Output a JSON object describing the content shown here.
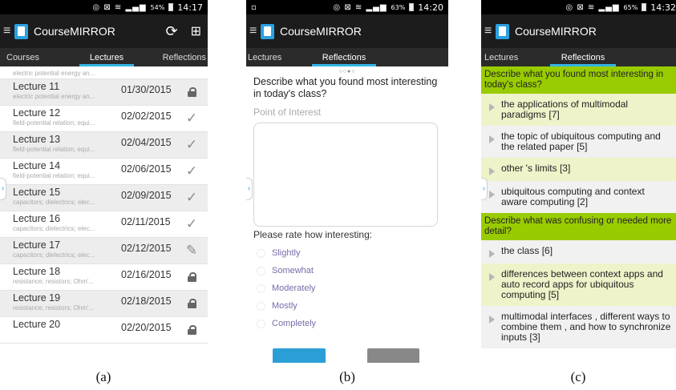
{
  "panel_a": {
    "time": "14:17",
    "battery": "54%",
    "app_title": "CourseMIRROR",
    "tabs": [
      "Courses",
      "Lectures",
      "Reflections"
    ],
    "partial_top_subtitle": "electric potential energy an...",
    "lectures": [
      {
        "name": "Lecture 11",
        "subtitle": "electric potential energy an...",
        "date": "01/30/2015",
        "status": "lock-icon"
      },
      {
        "name": "Lecture 12",
        "subtitle": "field-potential relation; equi...",
        "date": "02/02/2015",
        "status": "checkmark-icon"
      },
      {
        "name": "Lecture 13",
        "subtitle": "field-potential relation; equi...",
        "date": "02/04/2015",
        "status": "checkmark-icon"
      },
      {
        "name": "Lecture 14",
        "subtitle": "field-potential relation; equi...",
        "date": "02/06/2015",
        "status": "checkmark-icon"
      },
      {
        "name": "Lecture 15",
        "subtitle": "capacitors; dielectrics; elec...",
        "date": "02/09/2015",
        "status": "checkmark-icon"
      },
      {
        "name": "Lecture 16",
        "subtitle": "capacitors; dielectrics; elec...",
        "date": "02/11/2015",
        "status": "checkmark-icon"
      },
      {
        "name": "Lecture 17",
        "subtitle": "capacitors; dielectrics; elec...",
        "date": "02/12/2015",
        "status": "pencil-icon"
      },
      {
        "name": "Lecture 18",
        "subtitle": "resistance; resistors; Ohm'...",
        "date": "02/16/2015",
        "status": "lock-icon"
      },
      {
        "name": "Lecture 19",
        "subtitle": "resistance; resistors; Ohm'...",
        "date": "02/18/2015",
        "status": "lock-icon"
      },
      {
        "name": "Lecture 20",
        "subtitle": "",
        "date": "02/20/2015",
        "status": "lock-icon"
      }
    ],
    "caption": "(a)"
  },
  "panel_b": {
    "time": "14:20",
    "battery": "63%",
    "app_title": "CourseMIRROR",
    "tabs": [
      "Lectures",
      "Reflections"
    ],
    "page_dots": "○○●○",
    "question": "Describe what you found most interesting in today's class?",
    "answer_placeholder": "Point of Interest",
    "rating_label": "Please rate how interesting:",
    "rating_options": [
      "Slightly",
      "Somewhat",
      "Moderately",
      "Mostly",
      "Completely"
    ],
    "caption": "(b)"
  },
  "panel_c": {
    "time": "14:32",
    "battery": "65%",
    "app_title": "CourseMIRROR",
    "tabs": [
      "Lectures",
      "Reflections"
    ],
    "sections": [
      {
        "question": "Describe what you found most interesting in today's class?",
        "items": [
          {
            "text": "the applications of multimodal paradigms [7]",
            "tone": "yel"
          },
          {
            "text": "the topic of ubiquitous computing and the related paper [5]",
            "tone": "gry"
          },
          {
            "text": "other 's limits [3]",
            "tone": "yel"
          },
          {
            "text": "ubiquitous computing and context aware computing [2]",
            "tone": "gry"
          }
        ]
      },
      {
        "question": "Describe what was confusing or needed more detail?",
        "items": [
          {
            "text": "the class [6]",
            "tone": "gry"
          },
          {
            "text": "differences between context apps and auto record apps for ubiquitous computing [5]",
            "tone": "yel"
          },
          {
            "text": "multimodal interfaces , different ways to combine them , and how to synchronize inputs [3]",
            "tone": "gry"
          }
        ]
      }
    ],
    "caption": "(c)"
  },
  "colors": {
    "accent_blue": "#33b5e5",
    "question_green": "#99cc00",
    "item_yellow": "#eef3c9",
    "item_gray": "#f1f1f1"
  }
}
